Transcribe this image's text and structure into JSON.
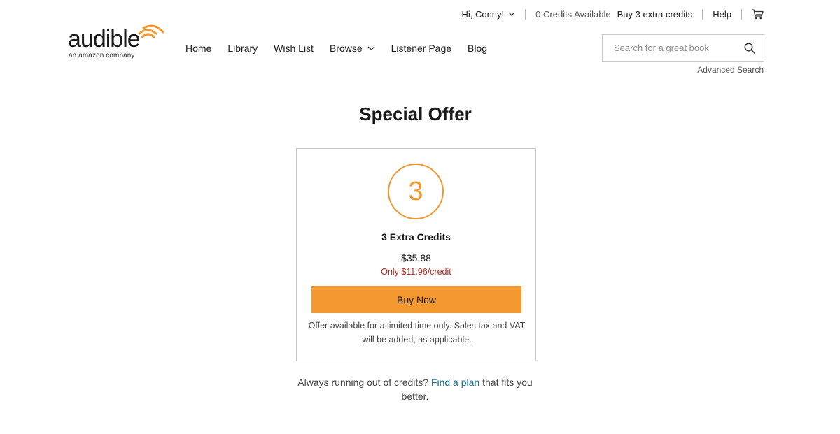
{
  "topbar": {
    "greeting": "Hi, Conny!",
    "credits_available": "0 Credits Available",
    "buy_extra": "Buy 3 extra credits",
    "help": "Help",
    "cart_icon": "cart-icon"
  },
  "logo": {
    "wordmark": "audible",
    "tagline": "an amazon company",
    "accent_color": "#f3972e"
  },
  "nav": {
    "items": [
      {
        "label": "Home"
      },
      {
        "label": "Library"
      },
      {
        "label": "Wish List"
      },
      {
        "label": "Browse",
        "has_dropdown": true
      },
      {
        "label": "Listener Page"
      },
      {
        "label": "Blog"
      }
    ]
  },
  "search": {
    "placeholder": "Search for a great book",
    "value": "",
    "icon": "search-icon",
    "advanced_label": "Advanced Search"
  },
  "main": {
    "title": "Special Offer",
    "offer": {
      "credit_count": "3",
      "name": "3 Extra Credits",
      "price": "$35.88",
      "per_credit": "Only $11.96/credit",
      "button_label": "Buy Now",
      "disclaimer": "Offer available for a limited time only. Sales tax and VAT will be added, as applicable.",
      "button_color": "#f3992f",
      "per_credit_color": "#b3261e"
    },
    "footer": {
      "before": "Always running out of credits?",
      "link": "Find a plan",
      "after": "that fits you better.",
      "link_color": "#0f6a8b"
    }
  }
}
